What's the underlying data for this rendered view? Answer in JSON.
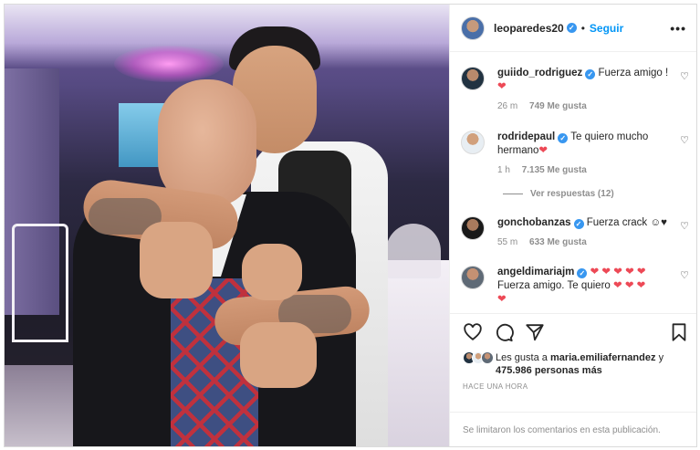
{
  "header": {
    "username": "leoparedes20",
    "separator": "•",
    "follow_label": "Seguir",
    "more_label": "•••"
  },
  "comments": [
    {
      "username": "guiido_rodriguez",
      "verified": true,
      "text": "Fuerza amigo !",
      "emoji": "❤",
      "time": "26 m",
      "likes": "749 Me gusta"
    },
    {
      "username": "rodridepaul",
      "verified": true,
      "text": "Te quiero mucho hermano",
      "emoji": "❤",
      "time": "1 h",
      "likes": "7.135 Me gusta",
      "view_replies": "Ver respuestas (12)"
    },
    {
      "username": "gonchobanzas",
      "verified": true,
      "text": "Fuerza crack",
      "emoji": "☺♥",
      "time": "55 m",
      "likes": "633 Me gusta"
    },
    {
      "username": "angeldimariajm",
      "verified": true,
      "emoji_top": "❤ ❤ ❤ ❤ ❤",
      "text": "Fuerza amigo. Te quiero",
      "emoji_inline": "❤ ❤ ❤",
      "emoji_end": "❤"
    }
  ],
  "likes": {
    "prefix": "Les gusta a",
    "user": "maria.emiliafernandez",
    "joiner": "y",
    "count": "475.986 personas más"
  },
  "time_ago": "HACE UNA HORA",
  "footer_note": "Se limitaron los comentarios en esta publicación.",
  "colors": {
    "accent": "#0095f6",
    "verified": "#3897f0",
    "heart": "#ed4956",
    "muted": "#8e8e8e"
  },
  "icons": [
    "heart-icon",
    "comment-icon",
    "share-icon",
    "save-icon",
    "like-comment-icon",
    "more-icon",
    "verified-icon"
  ]
}
